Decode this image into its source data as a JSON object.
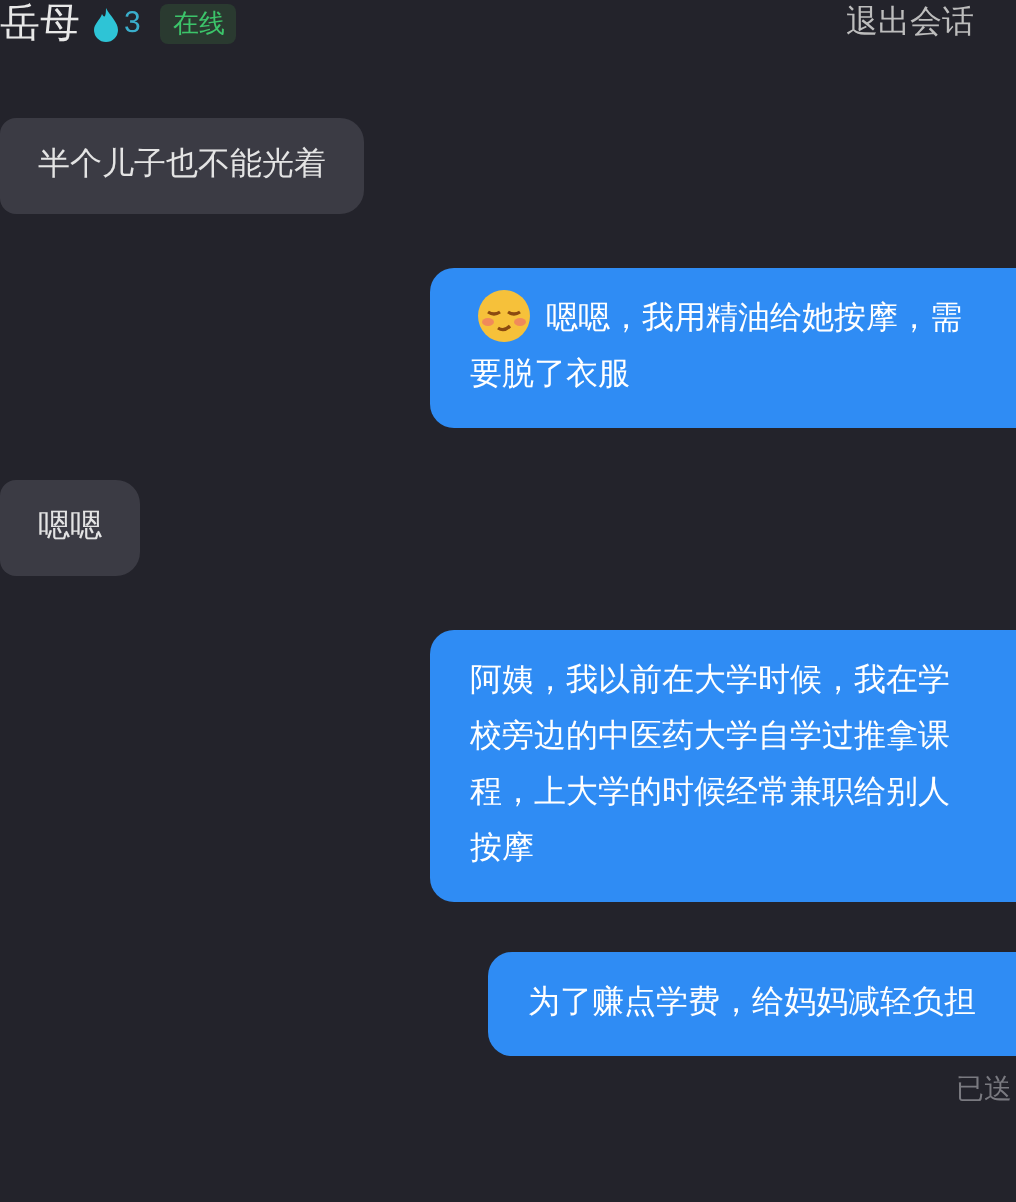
{
  "header": {
    "name": "岳母",
    "heat": "3",
    "status": "在线",
    "exit": "退出会话"
  },
  "messages": [
    {
      "kind": "incoming",
      "text": "半个儿子也不能光着",
      "emoji": false
    },
    {
      "kind": "outgoing",
      "text": "嗯嗯，我用精油给她按摩，需要脱了衣服",
      "emoji": true
    },
    {
      "kind": "incoming",
      "text": "嗯嗯",
      "emoji": false
    },
    {
      "kind": "outgoing",
      "text": "阿姨，我以前在大学时候，我在学校旁边的中医药大学自学过推拿课程，上大学的时候经常兼职给别人按摩",
      "emoji": false
    },
    {
      "kind": "outgoing",
      "text": "为了赚点学费，给妈妈减轻负担",
      "emoji": false
    }
  ],
  "delivery": "已送"
}
